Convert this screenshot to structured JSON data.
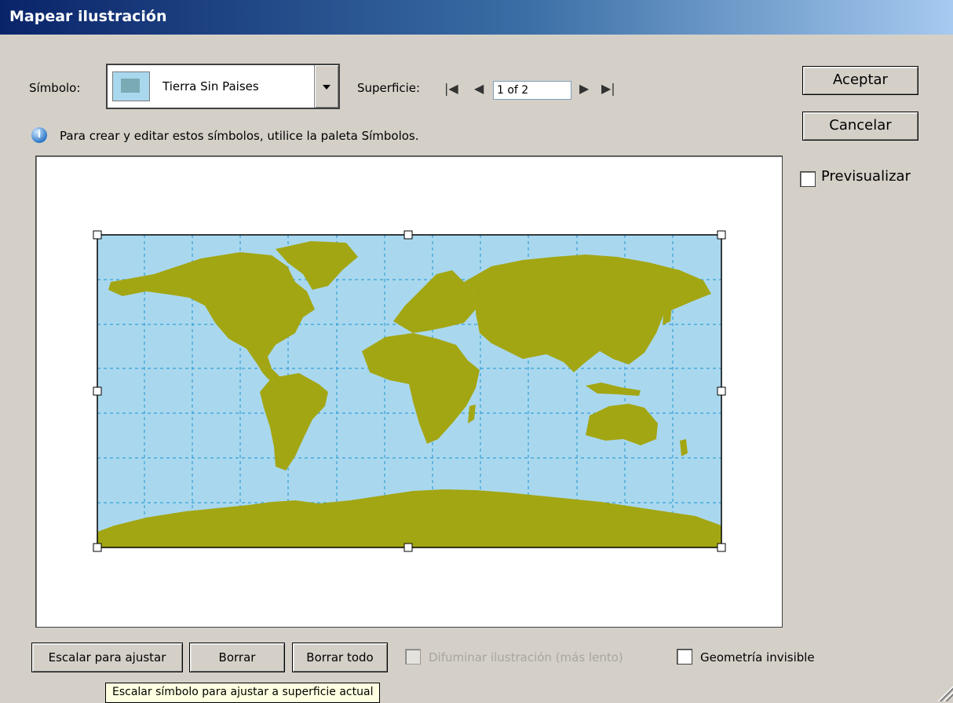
{
  "window": {
    "title": "Mapear ilustración"
  },
  "symbol": {
    "label": "Símbolo:",
    "selected": "Tierra Sin Paises",
    "thumb_icon": "world-map-icon"
  },
  "surface": {
    "label": "Superficie:",
    "value": "1 of 2",
    "first_icon": "first-page-icon",
    "prev_icon": "prev-page-icon",
    "next_icon": "next-page-icon",
    "last_icon": "last-page-icon"
  },
  "info": {
    "icon": "info-icon",
    "text": "Para crear y editar estos símbolos, utilice la paleta Símbolos."
  },
  "buttons": {
    "ok": "Aceptar",
    "cancel": "Cancelar",
    "scale": "Escalar para ajustar",
    "clear": "Borrar",
    "clear_all": "Borrar todo"
  },
  "options": {
    "preview": {
      "label": "Previsualizar",
      "checked": false
    },
    "shade": {
      "label": "Difuminar ilustración (más lento)",
      "checked": false,
      "enabled": false
    },
    "invisible": {
      "label": "Geometría invisible",
      "checked": false
    }
  },
  "tooltip": "Escalar símbolo para ajustar a superficie actual",
  "colors": {
    "ocean": "#a9d8ee",
    "land": "#a3a613",
    "grid": "#36a0d8",
    "title_start": "#0a246a",
    "title_end": "#a6caf0"
  }
}
